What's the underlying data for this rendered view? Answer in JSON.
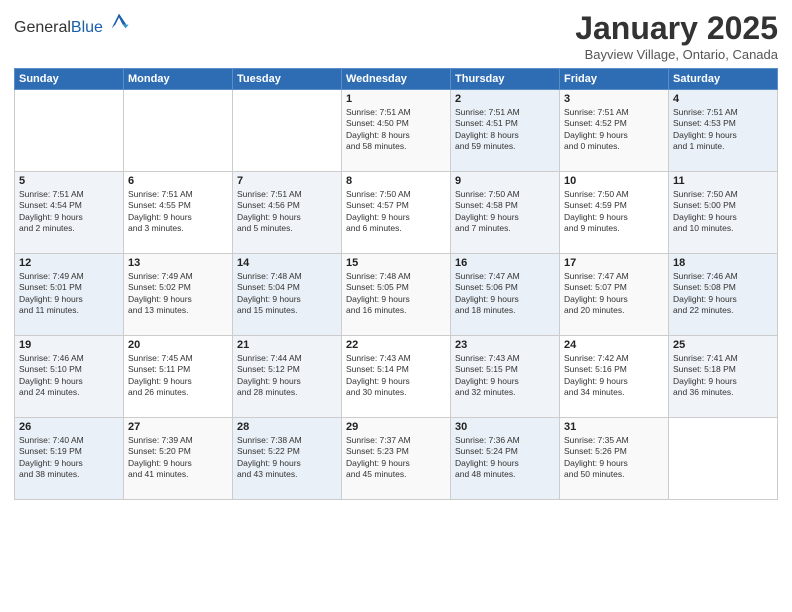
{
  "header": {
    "logo_general": "General",
    "logo_blue": "Blue",
    "month": "January 2025",
    "location": "Bayview Village, Ontario, Canada"
  },
  "days_of_week": [
    "Sunday",
    "Monday",
    "Tuesday",
    "Wednesday",
    "Thursday",
    "Friday",
    "Saturday"
  ],
  "weeks": [
    [
      {
        "day": "",
        "info": ""
      },
      {
        "day": "",
        "info": ""
      },
      {
        "day": "",
        "info": ""
      },
      {
        "day": "1",
        "info": "Sunrise: 7:51 AM\nSunset: 4:50 PM\nDaylight: 8 hours\nand 58 minutes."
      },
      {
        "day": "2",
        "info": "Sunrise: 7:51 AM\nSunset: 4:51 PM\nDaylight: 8 hours\nand 59 minutes."
      },
      {
        "day": "3",
        "info": "Sunrise: 7:51 AM\nSunset: 4:52 PM\nDaylight: 9 hours\nand 0 minutes."
      },
      {
        "day": "4",
        "info": "Sunrise: 7:51 AM\nSunset: 4:53 PM\nDaylight: 9 hours\nand 1 minute."
      }
    ],
    [
      {
        "day": "5",
        "info": "Sunrise: 7:51 AM\nSunset: 4:54 PM\nDaylight: 9 hours\nand 2 minutes."
      },
      {
        "day": "6",
        "info": "Sunrise: 7:51 AM\nSunset: 4:55 PM\nDaylight: 9 hours\nand 3 minutes."
      },
      {
        "day": "7",
        "info": "Sunrise: 7:51 AM\nSunset: 4:56 PM\nDaylight: 9 hours\nand 5 minutes."
      },
      {
        "day": "8",
        "info": "Sunrise: 7:50 AM\nSunset: 4:57 PM\nDaylight: 9 hours\nand 6 minutes."
      },
      {
        "day": "9",
        "info": "Sunrise: 7:50 AM\nSunset: 4:58 PM\nDaylight: 9 hours\nand 7 minutes."
      },
      {
        "day": "10",
        "info": "Sunrise: 7:50 AM\nSunset: 4:59 PM\nDaylight: 9 hours\nand 9 minutes."
      },
      {
        "day": "11",
        "info": "Sunrise: 7:50 AM\nSunset: 5:00 PM\nDaylight: 9 hours\nand 10 minutes."
      }
    ],
    [
      {
        "day": "12",
        "info": "Sunrise: 7:49 AM\nSunset: 5:01 PM\nDaylight: 9 hours\nand 11 minutes."
      },
      {
        "day": "13",
        "info": "Sunrise: 7:49 AM\nSunset: 5:02 PM\nDaylight: 9 hours\nand 13 minutes."
      },
      {
        "day": "14",
        "info": "Sunrise: 7:48 AM\nSunset: 5:04 PM\nDaylight: 9 hours\nand 15 minutes."
      },
      {
        "day": "15",
        "info": "Sunrise: 7:48 AM\nSunset: 5:05 PM\nDaylight: 9 hours\nand 16 minutes."
      },
      {
        "day": "16",
        "info": "Sunrise: 7:47 AM\nSunset: 5:06 PM\nDaylight: 9 hours\nand 18 minutes."
      },
      {
        "day": "17",
        "info": "Sunrise: 7:47 AM\nSunset: 5:07 PM\nDaylight: 9 hours\nand 20 minutes."
      },
      {
        "day": "18",
        "info": "Sunrise: 7:46 AM\nSunset: 5:08 PM\nDaylight: 9 hours\nand 22 minutes."
      }
    ],
    [
      {
        "day": "19",
        "info": "Sunrise: 7:46 AM\nSunset: 5:10 PM\nDaylight: 9 hours\nand 24 minutes."
      },
      {
        "day": "20",
        "info": "Sunrise: 7:45 AM\nSunset: 5:11 PM\nDaylight: 9 hours\nand 26 minutes."
      },
      {
        "day": "21",
        "info": "Sunrise: 7:44 AM\nSunset: 5:12 PM\nDaylight: 9 hours\nand 28 minutes."
      },
      {
        "day": "22",
        "info": "Sunrise: 7:43 AM\nSunset: 5:14 PM\nDaylight: 9 hours\nand 30 minutes."
      },
      {
        "day": "23",
        "info": "Sunrise: 7:43 AM\nSunset: 5:15 PM\nDaylight: 9 hours\nand 32 minutes."
      },
      {
        "day": "24",
        "info": "Sunrise: 7:42 AM\nSunset: 5:16 PM\nDaylight: 9 hours\nand 34 minutes."
      },
      {
        "day": "25",
        "info": "Sunrise: 7:41 AM\nSunset: 5:18 PM\nDaylight: 9 hours\nand 36 minutes."
      }
    ],
    [
      {
        "day": "26",
        "info": "Sunrise: 7:40 AM\nSunset: 5:19 PM\nDaylight: 9 hours\nand 38 minutes."
      },
      {
        "day": "27",
        "info": "Sunrise: 7:39 AM\nSunset: 5:20 PM\nDaylight: 9 hours\nand 41 minutes."
      },
      {
        "day": "28",
        "info": "Sunrise: 7:38 AM\nSunset: 5:22 PM\nDaylight: 9 hours\nand 43 minutes."
      },
      {
        "day": "29",
        "info": "Sunrise: 7:37 AM\nSunset: 5:23 PM\nDaylight: 9 hours\nand 45 minutes."
      },
      {
        "day": "30",
        "info": "Sunrise: 7:36 AM\nSunset: 5:24 PM\nDaylight: 9 hours\nand 48 minutes."
      },
      {
        "day": "31",
        "info": "Sunrise: 7:35 AM\nSunset: 5:26 PM\nDaylight: 9 hours\nand 50 minutes."
      },
      {
        "day": "",
        "info": ""
      }
    ]
  ]
}
